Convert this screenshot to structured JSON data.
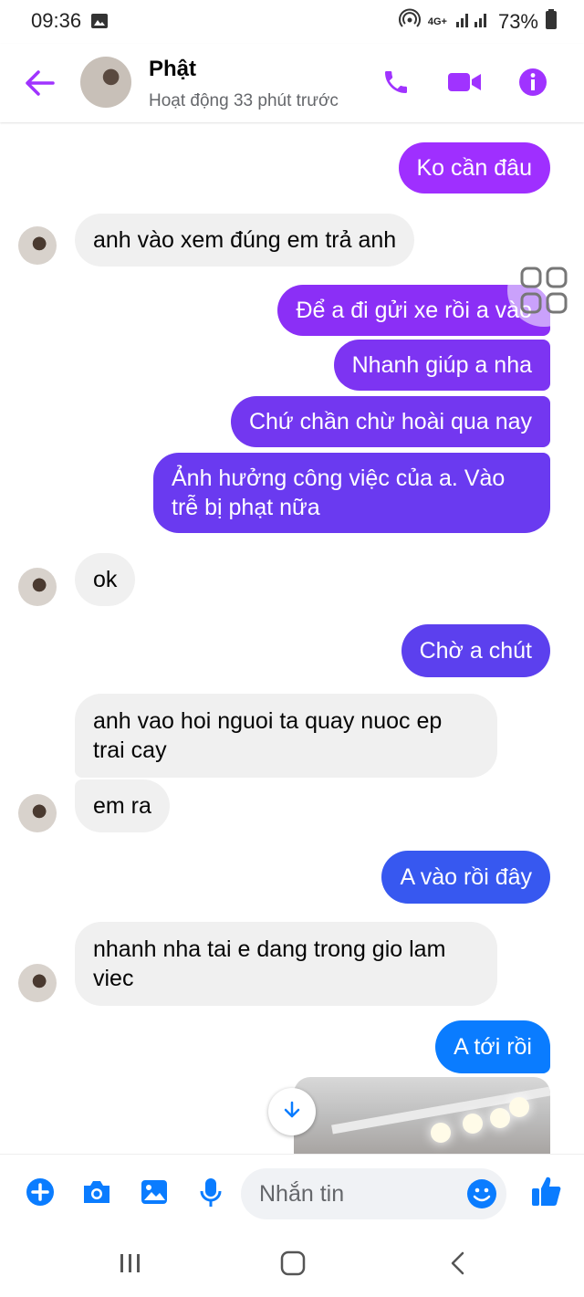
{
  "status_bar": {
    "time": "09:36",
    "network": "4G+",
    "battery": "73%"
  },
  "header": {
    "contact_name": "Phật",
    "activity": "Hoạt động 33 phút trước"
  },
  "messages": [
    {
      "dir": "out",
      "text": "Ko cần đâu"
    },
    {
      "dir": "in",
      "text": "anh vào xem đúng em trả anh"
    },
    {
      "dir": "out",
      "text": "Để a đi gửi xe rồi a vào"
    },
    {
      "dir": "out",
      "text": "Nhanh giúp a nha"
    },
    {
      "dir": "out",
      "text": "Chứ chần chừ hoài qua nay"
    },
    {
      "dir": "out",
      "text": "Ảnh hưởng công việc của a. Vào trễ bị phạt nữa"
    },
    {
      "dir": "in",
      "text": "ok"
    },
    {
      "dir": "out",
      "text": "Chờ a chút"
    },
    {
      "dir": "in",
      "text": "anh vao hoi nguoi ta quay nuoc ep trai cay"
    },
    {
      "dir": "in",
      "text": "em ra"
    },
    {
      "dir": "out",
      "text": "A vào rồi đây"
    },
    {
      "dir": "in",
      "text": "nhanh nha tai e dang trong gio lam viec"
    },
    {
      "dir": "out",
      "text": "A tới rồi"
    }
  ],
  "composer": {
    "placeholder": "Nhắn tin"
  },
  "colors": {
    "accent": "#a033ff",
    "incoming_bg": "#f0f0f0",
    "blue": "#0a7cff"
  }
}
